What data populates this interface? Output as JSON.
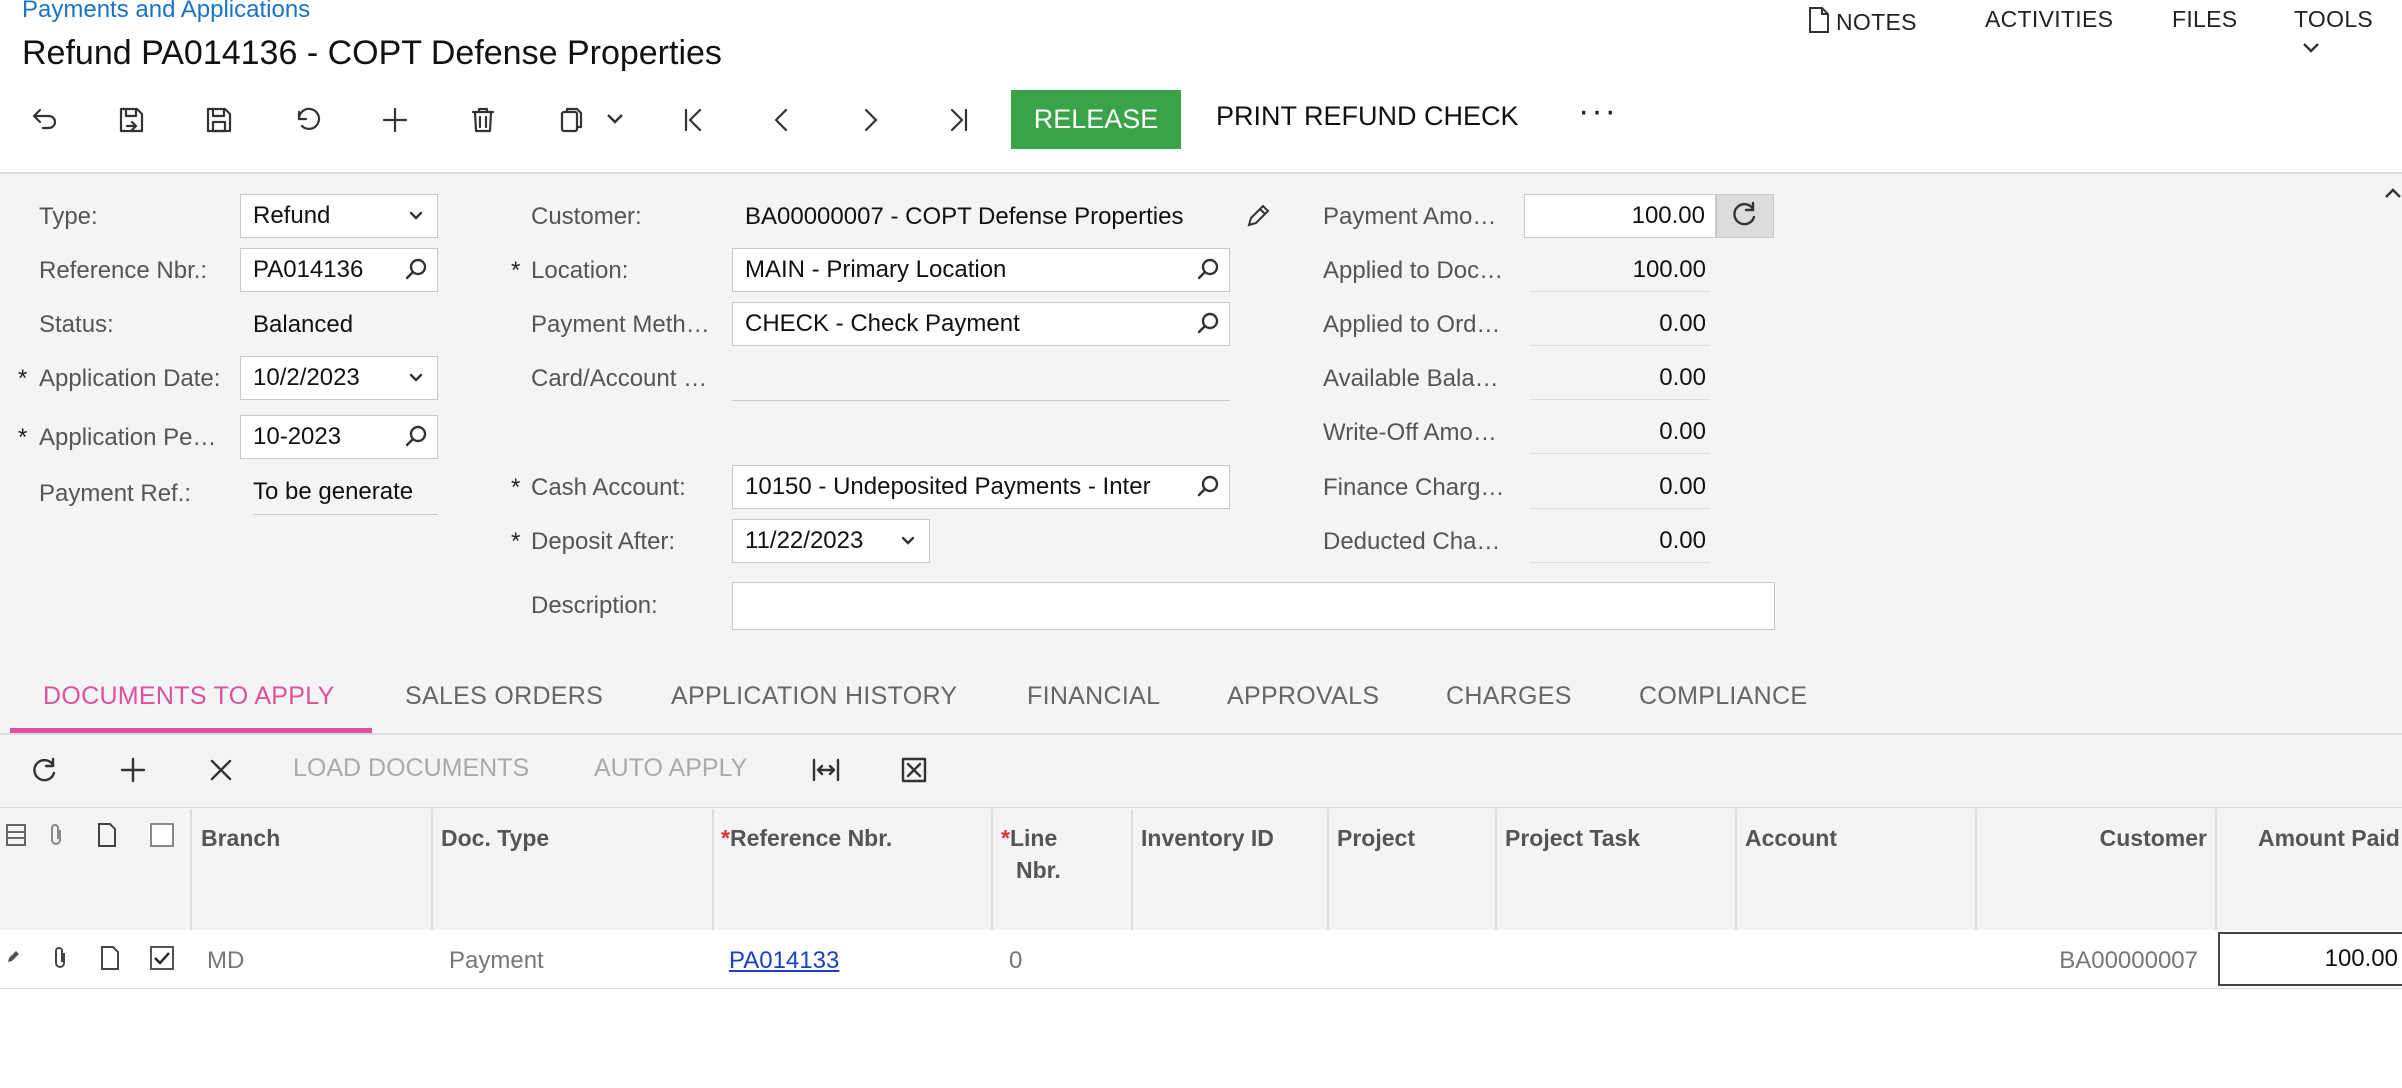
{
  "header": {
    "breadcrumb": "Payments and Applications",
    "title": "Refund PA014136 - COPT Defense Properties",
    "menu": {
      "notes": "NOTES",
      "activities": "ACTIVITIES",
      "files": "FILES",
      "tools": "TOOLS"
    }
  },
  "toolbar": {
    "release": "RELEASE",
    "print_refund_check": "PRINT REFUND CHECK",
    "more": "···"
  },
  "form": {
    "type": {
      "label": "Type:",
      "value": "Refund"
    },
    "reference_nbr": {
      "label": "Reference Nbr.:",
      "value": "PA014136"
    },
    "status": {
      "label": "Status:",
      "value": "Balanced"
    },
    "application_date": {
      "label": "Application Date:",
      "value": "10/2/2023"
    },
    "application_period": {
      "label": "Application Pe…",
      "value": "10-2023"
    },
    "payment_ref": {
      "label": "Payment Ref.:",
      "value": "To be generate"
    },
    "customer": {
      "label": "Customer:",
      "value": "BA00000007 - COPT Defense Properties"
    },
    "location": {
      "label": "Location:",
      "value": "MAIN - Primary Location"
    },
    "payment_method": {
      "label": "Payment Meth…",
      "value": "CHECK - Check Payment"
    },
    "card_account": {
      "label": "Card/Account …",
      "value": ""
    },
    "cash_account": {
      "label": "Cash Account:",
      "value": "10150 - Undeposited Payments - Inter"
    },
    "deposit_after": {
      "label": "Deposit After:",
      "value": "11/22/2023"
    },
    "description": {
      "label": "Description:",
      "value": ""
    },
    "payment_amount": {
      "label": "Payment Amo…",
      "value": "100.00"
    },
    "applied_to_doc": {
      "label": "Applied to Doc…",
      "value": "100.00"
    },
    "applied_to_order": {
      "label": "Applied to Ord…",
      "value": "0.00"
    },
    "available_balance": {
      "label": "Available Bala…",
      "value": "0.00"
    },
    "write_off_amount": {
      "label": "Write-Off Amo…",
      "value": "0.00"
    },
    "finance_charges": {
      "label": "Finance Charg…",
      "value": "0.00"
    },
    "deducted_charges": {
      "label": "Deducted Cha…",
      "value": "0.00"
    }
  },
  "tabs": [
    "DOCUMENTS TO APPLY",
    "SALES ORDERS",
    "APPLICATION HISTORY",
    "FINANCIAL",
    "APPROVALS",
    "CHARGES",
    "COMPLIANCE"
  ],
  "grid_toolbar": {
    "load_documents": "LOAD DOCUMENTS",
    "auto_apply": "AUTO APPLY"
  },
  "grid": {
    "columns": {
      "branch": "Branch",
      "doc_type": "Doc. Type",
      "reference_nbr": "Reference Nbr.",
      "line_nbr_1": "Line",
      "line_nbr_2": "Nbr.",
      "inventory_id": "Inventory ID",
      "project": "Project",
      "project_task": "Project Task",
      "account": "Account",
      "customer": "Customer",
      "amount_paid": "Amount Paid"
    },
    "rows": [
      {
        "branch": "MD",
        "doc_type": "Payment",
        "reference_nbr": "PA014133",
        "line_nbr": "0",
        "customer": "BA00000007",
        "amount_paid": "100.00",
        "selected": true
      }
    ]
  },
  "colors": {
    "accent": "#e0509a",
    "release": "#3aa34a",
    "link": "#1a73c9"
  }
}
